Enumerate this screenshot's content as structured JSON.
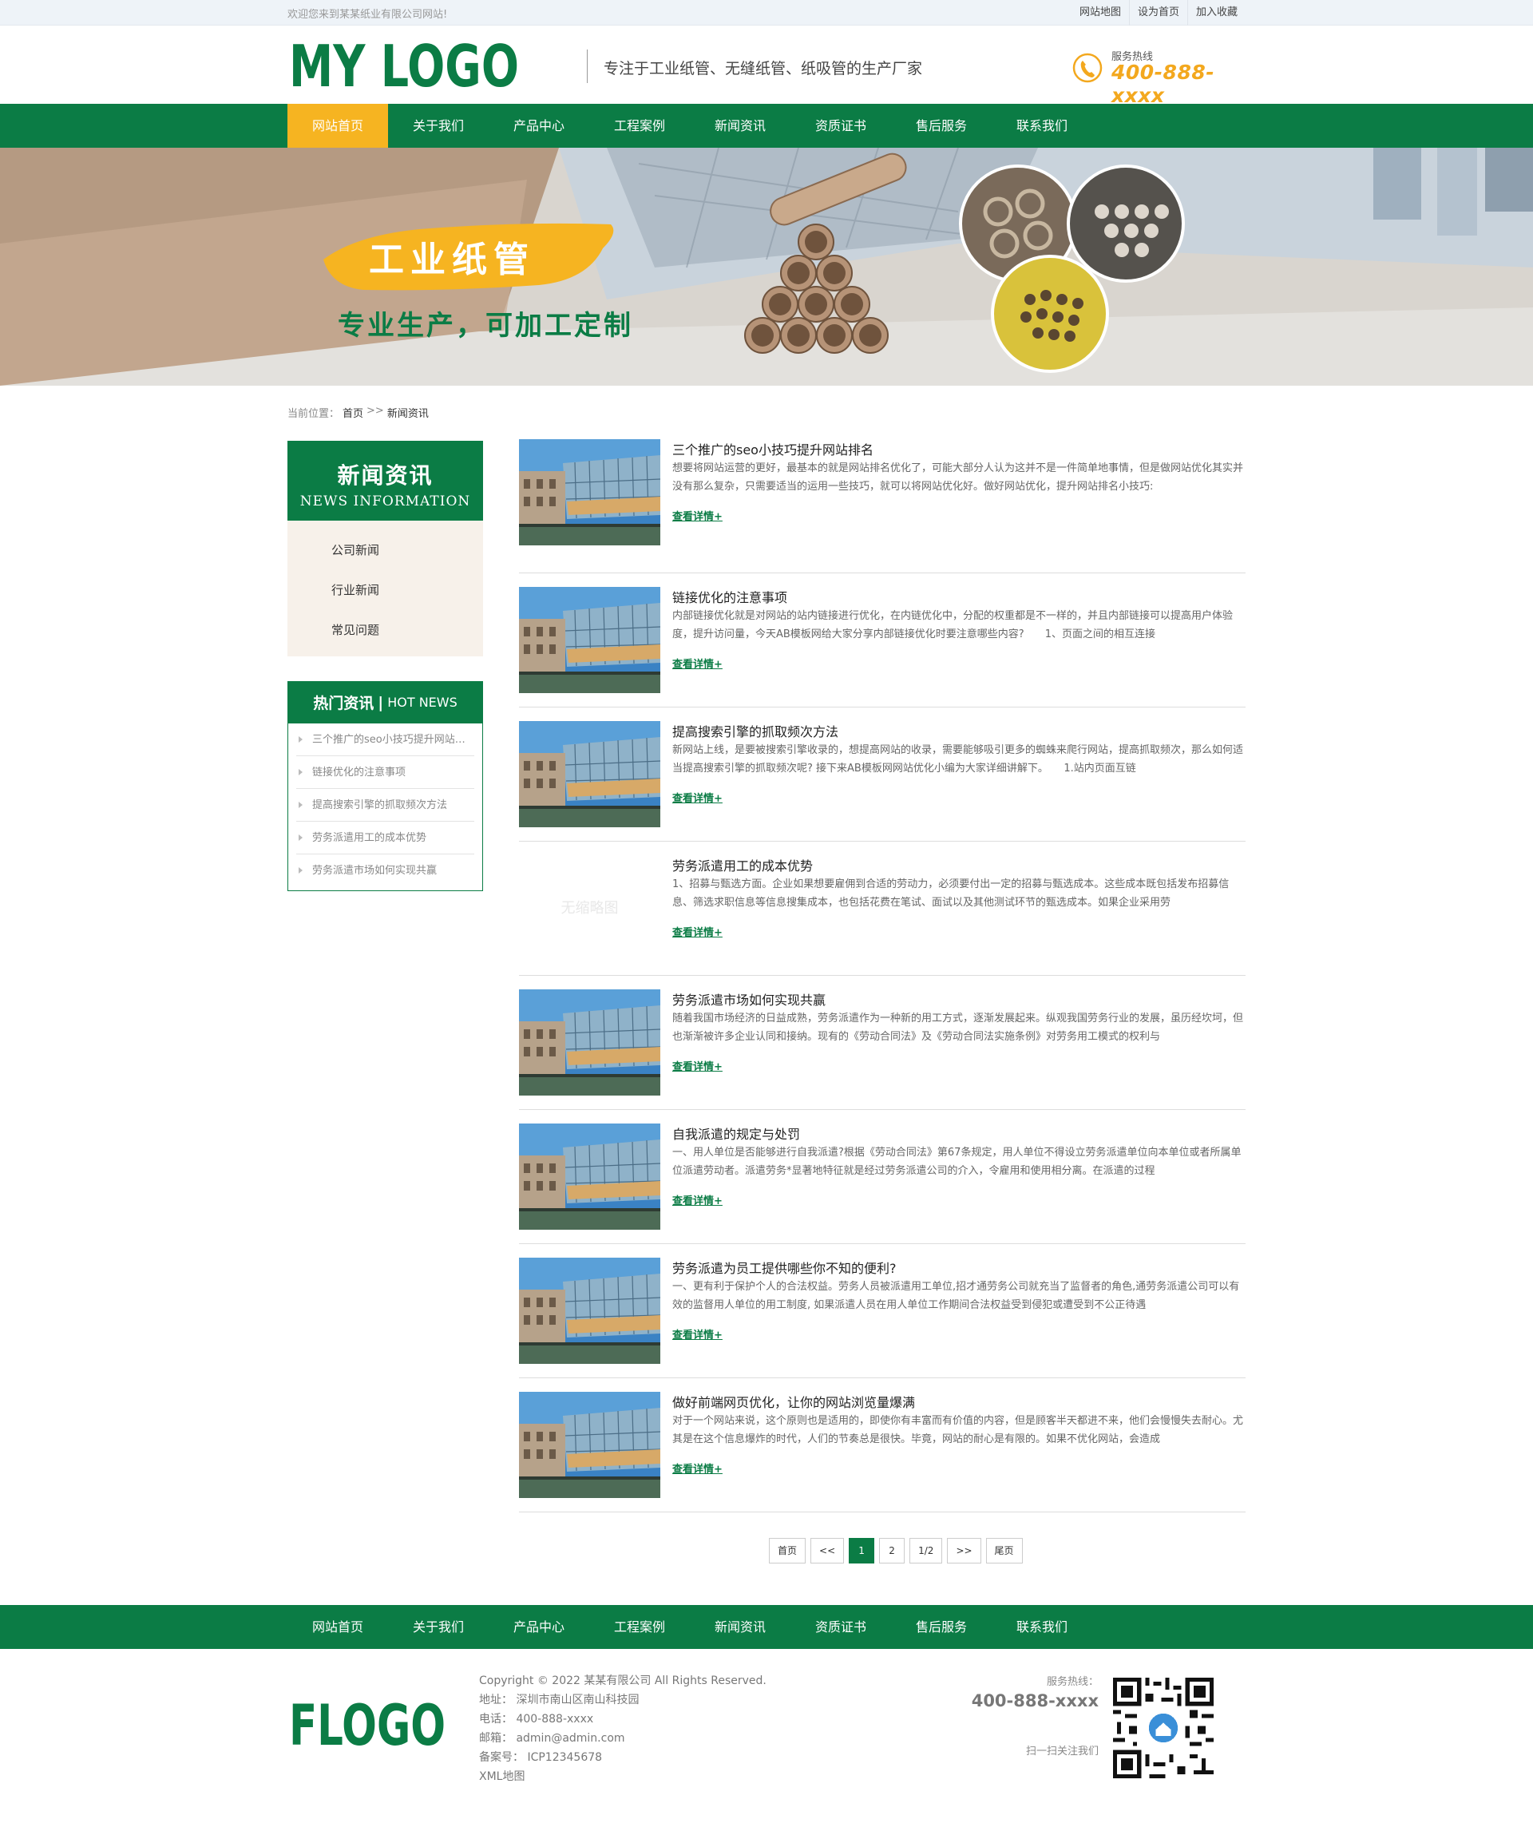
{
  "topbar": {
    "welcome": "欢迎您来到某某纸业有限公司网站!",
    "links": [
      "网站地图",
      "设为首页",
      "加入收藏"
    ]
  },
  "header": {
    "logo_text": "MY LOGO",
    "slogan": "专注于工业纸管、无缝纸管、纸吸管的生产厂家",
    "hotline_label": "服务热线",
    "hotline_number": "400-888-xxxx"
  },
  "nav": [
    "网站首页",
    "关于我们",
    "产品中心",
    "工程案例",
    "新闻资讯",
    "资质证书",
    "售后服务",
    "联系我们"
  ],
  "banner": {
    "title": "工业纸管",
    "subtitle": "专业生产，可加工定制"
  },
  "breadcrumb": {
    "prefix": "当前位置：",
    "home": "首页",
    "sep": ">>",
    "current": "新闻资讯"
  },
  "sidebar": {
    "category_title": "新闻资讯",
    "category_en": "NEWS INFORMATION",
    "categories": [
      "公司新闻",
      "行业新闻",
      "常见问题"
    ],
    "hot_title": "热门资讯",
    "hot_en": "HOT NEWS",
    "hot_items": [
      "三个推广的seo小技巧提升网站排名",
      "链接优化的注意事项",
      "提高搜索引擎的抓取频次方法",
      "劳务派遣用工的成本优势",
      "劳务派遣市场如何实现共赢"
    ]
  },
  "news": {
    "more_label": "查看详情+",
    "no_image_label": "无缩略图",
    "items": [
      {
        "title": "三个推广的seo小技巧提升网站排名",
        "desc": "想要将网站运营的更好，最基本的就是网站排名优化了，可能大部分人认为这并不是一件简单地事情，但是做网站优化其实并没有那么复杂，只需要适当的运用一些技巧，就可以将网站优化好。做好网站优化，提升网站排名小技巧:",
        "has_image": true
      },
      {
        "title": "链接优化的注意事项",
        "desc": "内部链接优化就是对网站的站内链接进行优化，在内链优化中，分配的权重都是不一样的，并且内部链接可以提高用户体验度，提升访问量，今天AB模板网给大家分享内部链接优化时要注意哪些内容?　　1、页面之间的相互连接",
        "has_image": true
      },
      {
        "title": "提高搜索引擎的抓取频次方法",
        "desc": "新网站上线，是要被搜索引擎收录的，想提高网站的收录，需要能够吸引更多的蜘蛛来爬行网站，提高抓取频次，那么如何适当提高搜索引擎的抓取频次呢? 接下来AB模板网网站优化小编为大家详细讲解下。　　1.站内页面互链",
        "has_image": true
      },
      {
        "title": "劳务派遣用工的成本优势",
        "desc": "1、招募与甄选方面。企业如果想要雇佣到合适的劳动力，必须要付出一定的招募与甄选成本。这些成本既包括发布招募信息、筛选求职信息等信息搜集成本，也包括花费在笔试、面试以及其他测试环节的甄选成本。如果企业采用劳",
        "has_image": false
      },
      {
        "title": "劳务派遣市场如何实现共赢",
        "desc": "随着我国市场经济的日益成熟，劳务派遣作为一种新的用工方式，逐渐发展起来。纵观我国劳务行业的发展，虽历经坎坷，但也渐渐被许多企业认同和接纳。现有的《劳动合同法》及《劳动合同法实施条例》对劳务用工模式的权利与",
        "has_image": true
      },
      {
        "title": "自我派遣的规定与处罚",
        "desc": "一、用人单位是否能够进行自我派遣?根据《劳动合同法》第67条规定，用人单位不得设立劳务派遣单位向本单位或者所属单位派遣劳动者。派遣劳务*显著地特征就是经过劳务派遣公司的介入，令雇用和使用相分离。在派遣的过程",
        "has_image": true
      },
      {
        "title": "劳务派遣为员工提供哪些你不知的便利?",
        "desc": "一、更有利于保护个人的合法权益。劳务人员被派遣用工单位,招才通劳务公司就充当了监督者的角色,通劳务派遣公司可以有效的监督用人单位的用工制度, 如果派遣人员在用人单位工作期间合法权益受到侵犯或遭受到不公正待遇",
        "has_image": true
      },
      {
        "title": "做好前端网页优化，让你的网站浏览量爆满",
        "desc": "对于一个网站来说，这个原则也是适用的，即使你有丰富而有价值的内容，但是顾客半天都进不来，他们会慢慢失去耐心。尤其是在这个信息爆炸的时代，人们的节奏总是很快。毕竟，网站的耐心是有限的。如果不优化网站，会造成",
        "has_image": true
      }
    ]
  },
  "pagination": {
    "items": [
      "首页",
      "<<",
      "1",
      "2",
      "1/2",
      ">>",
      "尾页"
    ],
    "current": "1"
  },
  "footer_nav": [
    "网站首页",
    "关于我们",
    "产品中心",
    "工程案例",
    "新闻资讯",
    "资质证书",
    "售后服务",
    "联系我们"
  ],
  "footer": {
    "logo_text": "FLOGO",
    "copyright": "Copyright © 2022 某某有限公司 All Rights Reserved.",
    "address": "地址： 深圳市南山区南山科技园",
    "phone": "电话： 400-888-xxxx",
    "email": "邮箱： admin@admin.com",
    "icp": "备案号： ICP12345678",
    "xml": "XML地图",
    "hotline_label": "服务热线：",
    "hotline_number": "400-888-xxxx",
    "scan_text": "扫一扫关注我们"
  },
  "colors": {
    "brand_green": "#0b7c45",
    "accent_yellow": "#f6b421",
    "hotline_orange": "#f3a81e"
  }
}
